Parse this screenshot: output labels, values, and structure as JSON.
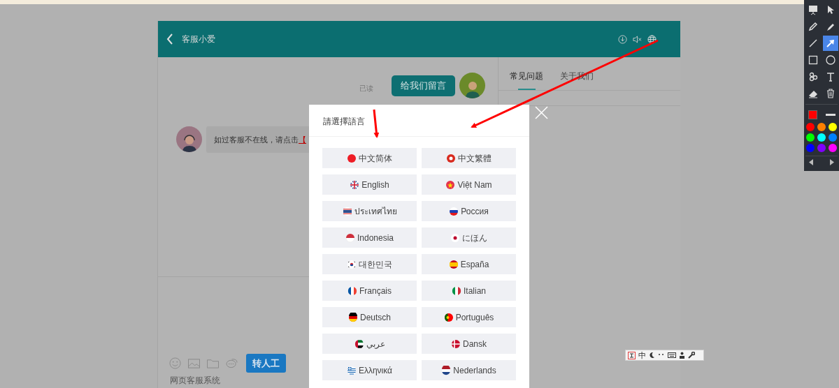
{
  "chat_window": {
    "header": {
      "title": "客服小爱"
    },
    "messages": [
      {
        "kind": "outgoing",
        "read_label": "已读",
        "text": "给我们留言"
      },
      {
        "kind": "incoming",
        "text": "如过客服不在线，请点击",
        "link": "【"
      }
    ],
    "transfer_button": "转人工",
    "footer": "网页客服系统",
    "side_tabs": [
      {
        "label": "常见问题",
        "selected": true
      },
      {
        "label": "关于我们",
        "selected": false
      }
    ]
  },
  "language_dialog": {
    "title": "請選擇語言",
    "languages": [
      {
        "label": "中文简体",
        "kind": "cn"
      },
      {
        "label": "中文繁體",
        "kind": "hk"
      },
      {
        "label": "English",
        "kind": "gb"
      },
      {
        "label": "Việt Nam",
        "kind": "vn"
      },
      {
        "label": "ประเทศไทย",
        "kind": "th"
      },
      {
        "label": "Россия",
        "kind": "ru"
      },
      {
        "label": "Indonesia",
        "kind": "id"
      },
      {
        "label": "にほん",
        "kind": "jp"
      },
      {
        "label": "대한민국",
        "kind": "kr"
      },
      {
        "label": "España",
        "kind": "es"
      },
      {
        "label": "Français",
        "kind": "fr"
      },
      {
        "label": "Italian",
        "kind": "it"
      },
      {
        "label": "Deutsch",
        "kind": "de"
      },
      {
        "label": "Português",
        "kind": "pt"
      },
      {
        "label": "عربي",
        "kind": "ae"
      },
      {
        "label": "Dansk",
        "kind": "dk"
      },
      {
        "label": "Ελληνικά",
        "kind": "gr"
      },
      {
        "label": "Nederlands",
        "kind": "nl"
      }
    ]
  },
  "annotation_toolbar": {
    "tools": [
      {
        "kind": "screen",
        "selected": false
      },
      {
        "kind": "pointer",
        "selected": false
      },
      {
        "kind": "pencil",
        "selected": false
      },
      {
        "kind": "marker",
        "selected": false
      },
      {
        "kind": "line",
        "selected": false
      },
      {
        "kind": "arrow",
        "selected": true
      },
      {
        "kind": "rectangle",
        "selected": false
      },
      {
        "kind": "ellipse",
        "selected": false
      },
      {
        "kind": "stamp",
        "selected": false
      },
      {
        "kind": "text",
        "selected": false
      },
      {
        "kind": "eraser",
        "selected": false
      },
      {
        "kind": "trash",
        "selected": false
      }
    ],
    "swatches": [
      {
        "color": "#ff0000"
      },
      {
        "color": "#ff8000"
      },
      {
        "color": "#ffff00"
      },
      {
        "color": "#00ff00"
      },
      {
        "color": "#00ffff"
      },
      {
        "color": "#0080ff"
      },
      {
        "color": "#0000ff"
      },
      {
        "color": "#8000ff"
      },
      {
        "color": "#ff00ff"
      }
    ]
  },
  "ime_toolbar": {
    "mode": "中"
  }
}
